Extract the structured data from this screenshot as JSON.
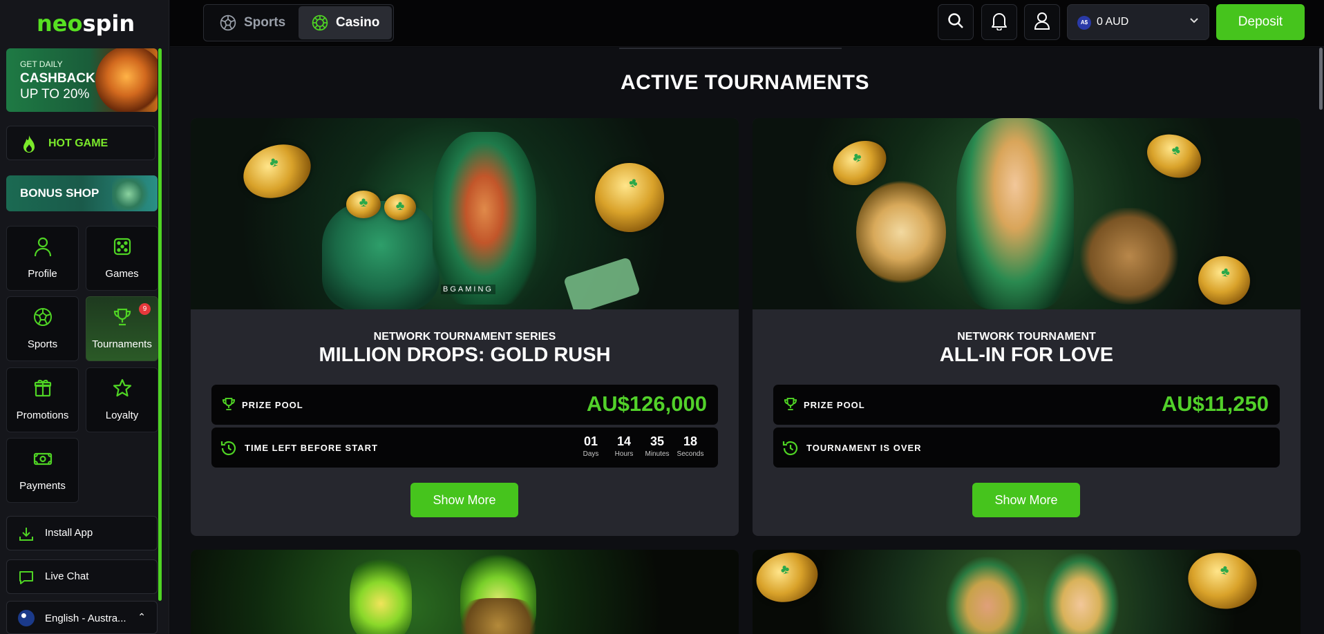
{
  "brand": {
    "logo_neo": "neo",
    "logo_spin": "spin"
  },
  "sidebar": {
    "cashback": {
      "line1": "GET DAILY",
      "line2": "CASHBACK",
      "line3": "UP TO 20%"
    },
    "hot_game": "HOT GAME",
    "bonus_shop": "BONUS SHOP",
    "tiles": [
      {
        "label": "Profile",
        "icon": "user-icon"
      },
      {
        "label": "Games",
        "icon": "dice-icon"
      },
      {
        "label": "Sports",
        "icon": "soccer-ball-icon"
      },
      {
        "label": "Tournaments",
        "icon": "trophy-icon",
        "badge": "9",
        "active": true
      },
      {
        "label": "Promotions",
        "icon": "gift-icon"
      },
      {
        "label": "Loyalty",
        "icon": "star-icon"
      },
      {
        "label": "Payments",
        "icon": "cash-icon"
      }
    ],
    "install_app": "Install App",
    "live_chat": "Live Chat",
    "language": "English - Austra..."
  },
  "topbar": {
    "sports_tab": "Sports",
    "casino_tab": "Casino",
    "currency_code": "A$",
    "balance": "0 AUD",
    "deposit": "Deposit"
  },
  "main": {
    "section_title": "ACTIVE TOURNAMENTS",
    "tournaments": [
      {
        "subtitle": "NETWORK TOURNAMENT SERIES",
        "title": "MILLION DROPS: GOLD RUSH",
        "prize_label": "PRIZE POOL",
        "prize": "AU$126,000",
        "time_label": "TIME LEFT BEFORE START",
        "timer": [
          {
            "n": "01",
            "u": "Days"
          },
          {
            "n": "14",
            "u": "Hours"
          },
          {
            "n": "35",
            "u": "Minutes"
          },
          {
            "n": "18",
            "u": "Seconds"
          }
        ],
        "provider": "BGAMING",
        "button": "Show More"
      },
      {
        "subtitle": "NETWORK TOURNAMENT",
        "title": "ALL-IN FOR LOVE",
        "prize_label": "PRIZE POOL",
        "prize": "AU$11,250",
        "time_label": "TOURNAMENT IS OVER",
        "button": "Show More"
      }
    ]
  },
  "colors": {
    "accent": "#46c41d",
    "prize": "#52d12a",
    "sidebar_scroll": "#4fd424"
  }
}
